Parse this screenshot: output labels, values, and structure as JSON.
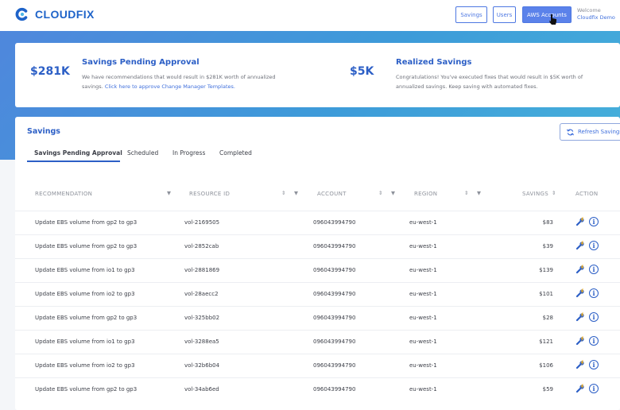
{
  "header": {
    "logo_text": "CLOUDFIX",
    "nav": [
      {
        "label": "Savings",
        "active": false
      },
      {
        "label": "Users",
        "active": false
      },
      {
        "label": "AWS Accounts",
        "active": true
      }
    ],
    "welcome_line1": "Welcome",
    "welcome_line2": "Cloudfix Demo"
  },
  "summary": {
    "pending": {
      "value": "$281K",
      "title": "Savings Pending Approval",
      "desc": "We have recommendations that would result in $281K worth of annualized savings.",
      "link": "Click here to approve Change Manager Templates."
    },
    "realized": {
      "value": "$5K",
      "title": "Realized Savings",
      "desc": "Congratulations! You've executed fixes that would result in $5K worth of annualized savings. Keep saving with automated fixes."
    }
  },
  "savings": {
    "title": "Savings",
    "refresh_label": "Refresh Savings",
    "tabs": [
      "Savings Pending Approval",
      "Scheduled",
      "In Progress",
      "Completed"
    ],
    "active_tab": 0,
    "columns": {
      "recommendation": "RECOMMENDATION",
      "resource_id": "RESOURCE ID",
      "account": "ACCOUNT",
      "region": "REGION",
      "savings": "SAVINGS",
      "action": "ACTION"
    },
    "rows": [
      {
        "recommendation": "Update EBS volume from gp2 to gp3",
        "resource_id": "vol-2169505",
        "account": "096043994790",
        "region": "eu-west-1",
        "savings": "$83"
      },
      {
        "recommendation": "Update EBS volume from gp2 to gp3",
        "resource_id": "vol-2852cab",
        "account": "096043994790",
        "region": "eu-west-1",
        "savings": "$39"
      },
      {
        "recommendation": "Update EBS volume from io1 to gp3",
        "resource_id": "vol-2881869",
        "account": "096043994790",
        "region": "eu-west-1",
        "savings": "$139"
      },
      {
        "recommendation": "Update EBS volume from io2 to gp3",
        "resource_id": "vol-28aecc2",
        "account": "096043994790",
        "region": "eu-west-1",
        "savings": "$101"
      },
      {
        "recommendation": "Update EBS volume from gp2 to gp3",
        "resource_id": "vol-325bb02",
        "account": "096043994790",
        "region": "eu-west-1",
        "savings": "$28"
      },
      {
        "recommendation": "Update EBS volume from io1 to gp3",
        "resource_id": "vol-3288ea5",
        "account": "096043994790",
        "region": "eu-west-1",
        "savings": "$121"
      },
      {
        "recommendation": "Update EBS volume from io2 to gp3",
        "resource_id": "vol-32b6b04",
        "account": "096043994790",
        "region": "eu-west-1",
        "savings": "$106"
      },
      {
        "recommendation": "Update EBS volume from gp2 to gp3",
        "resource_id": "vol-34ab6ed",
        "account": "096043994790",
        "region": "eu-west-1",
        "savings": "$59"
      }
    ]
  },
  "icons": {
    "sort": "sort-arrows-icon",
    "filter": "filter-funnel-icon",
    "fix": "wrench-bolt-icon",
    "info": "info-circle-icon",
    "refresh": "refresh-icon"
  },
  "colors": {
    "brand": "#1e63c9",
    "accent": "#5b82ea",
    "banner": "#4f87dc"
  }
}
